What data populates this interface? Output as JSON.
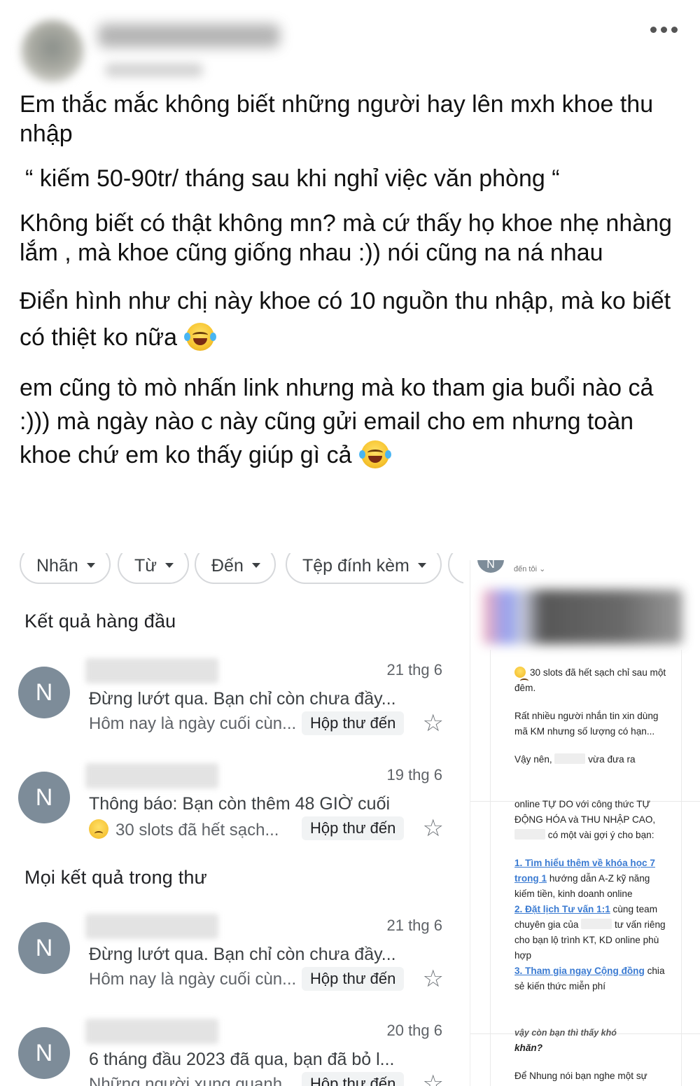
{
  "post": {
    "paragraphs": [
      "Em thắc mắc không biết những người hay lên mxh khoe thu nhập",
      "“ kiếm 50-90tr/ tháng sau khi nghỉ việc văn phòng “",
      "Không biết có thật không mn? mà cứ thấy họ khoe nhẹ nhàng lắm , mà khoe cũng giống nhau :)) nói cũng na ná nhau",
      "Điển hình như chị này khoe có 10 nguồn thu nhập, mà ko biết có thiệt ko nữa",
      "em cũng tò mò nhấn link nhưng mà ko tham gia buổi nào cả :))) mà ngày nào c này cũng gửi email cho em nhưng toàn khoe chứ em ko thấy giúp gì cả"
    ]
  },
  "gmail": {
    "chips": [
      "Nhãn",
      "Từ",
      "Đến",
      "Tệp đính kèm"
    ],
    "top_results_title": "Kết quả hàng đầu",
    "all_results_title": "Mọi kết quả trong thư",
    "emails": [
      {
        "avatar": "N",
        "date": "21 thg 6",
        "subject": "Đừng lướt qua. Bạn chỉ còn chưa đầy...",
        "snippet": "Hôm nay là ngày cuối cùn...",
        "label": "Hộp thư đến"
      },
      {
        "avatar": "N",
        "date": "19 thg 6",
        "subject": "Thông báo: Bạn còn thêm 48 GIỜ cuối",
        "snippet": "30 slots đã hết sạch...",
        "label": "Hộp thư đến"
      },
      {
        "avatar": "N",
        "date": "21 thg 6",
        "subject": "Đừng lướt qua. Bạn chỉ còn chưa đầy...",
        "snippet": "Hôm nay là ngày cuối cùn...",
        "label": "Hộp thư đến"
      },
      {
        "avatar": "N",
        "date": "20 thg 6",
        "subject": "6 tháng đầu 2023 đã qua, bạn đã bỏ l...",
        "snippet": "Những người xung quanh",
        "label": "Hộp thư đến"
      }
    ]
  },
  "email_view": {
    "avatar": "N",
    "to": "đến tôi ⌄",
    "line1": "30 slots đã hết sạch chỉ sau một đêm.",
    "line2": "Rất nhiều người nhắn tin xin dùng mã KM nhưng số lượng có hạn...",
    "line3a": "Vậy nên,",
    "line3b": "vừa đưa ra",
    "line4": "online TỰ DO với công thức TỰ ĐỘNG HÓA và THU NHẬP CAO,",
    "line4b": "có một vài gợi ý cho bạn:",
    "link1": "1. Tìm hiểu thêm về khóa học 7 trong 1",
    "link1_rest": "hướng dẫn A-Z kỹ năng kiếm tiền, kinh doanh online",
    "link2": "2. Đặt lịch Tư vấn 1:1",
    "link2_rest_a": "cùng team chuyên gia của",
    "link2_rest_b": "tư vấn riêng cho bạn lộ trình KT, KD online phù hợp",
    "link3": "3. Tham gia ngay Cộng đồng",
    "link3_rest": "chia sẻ kiến thức miễn phí",
    "question_cut": "vậy còn bạn thì thấy khó",
    "question_end": "khăn?",
    "last": "Để Nhung nói bạn nghe một sự"
  },
  "colors": {
    "avatar": "#7d8c99",
    "link": "#3b7bd2"
  }
}
